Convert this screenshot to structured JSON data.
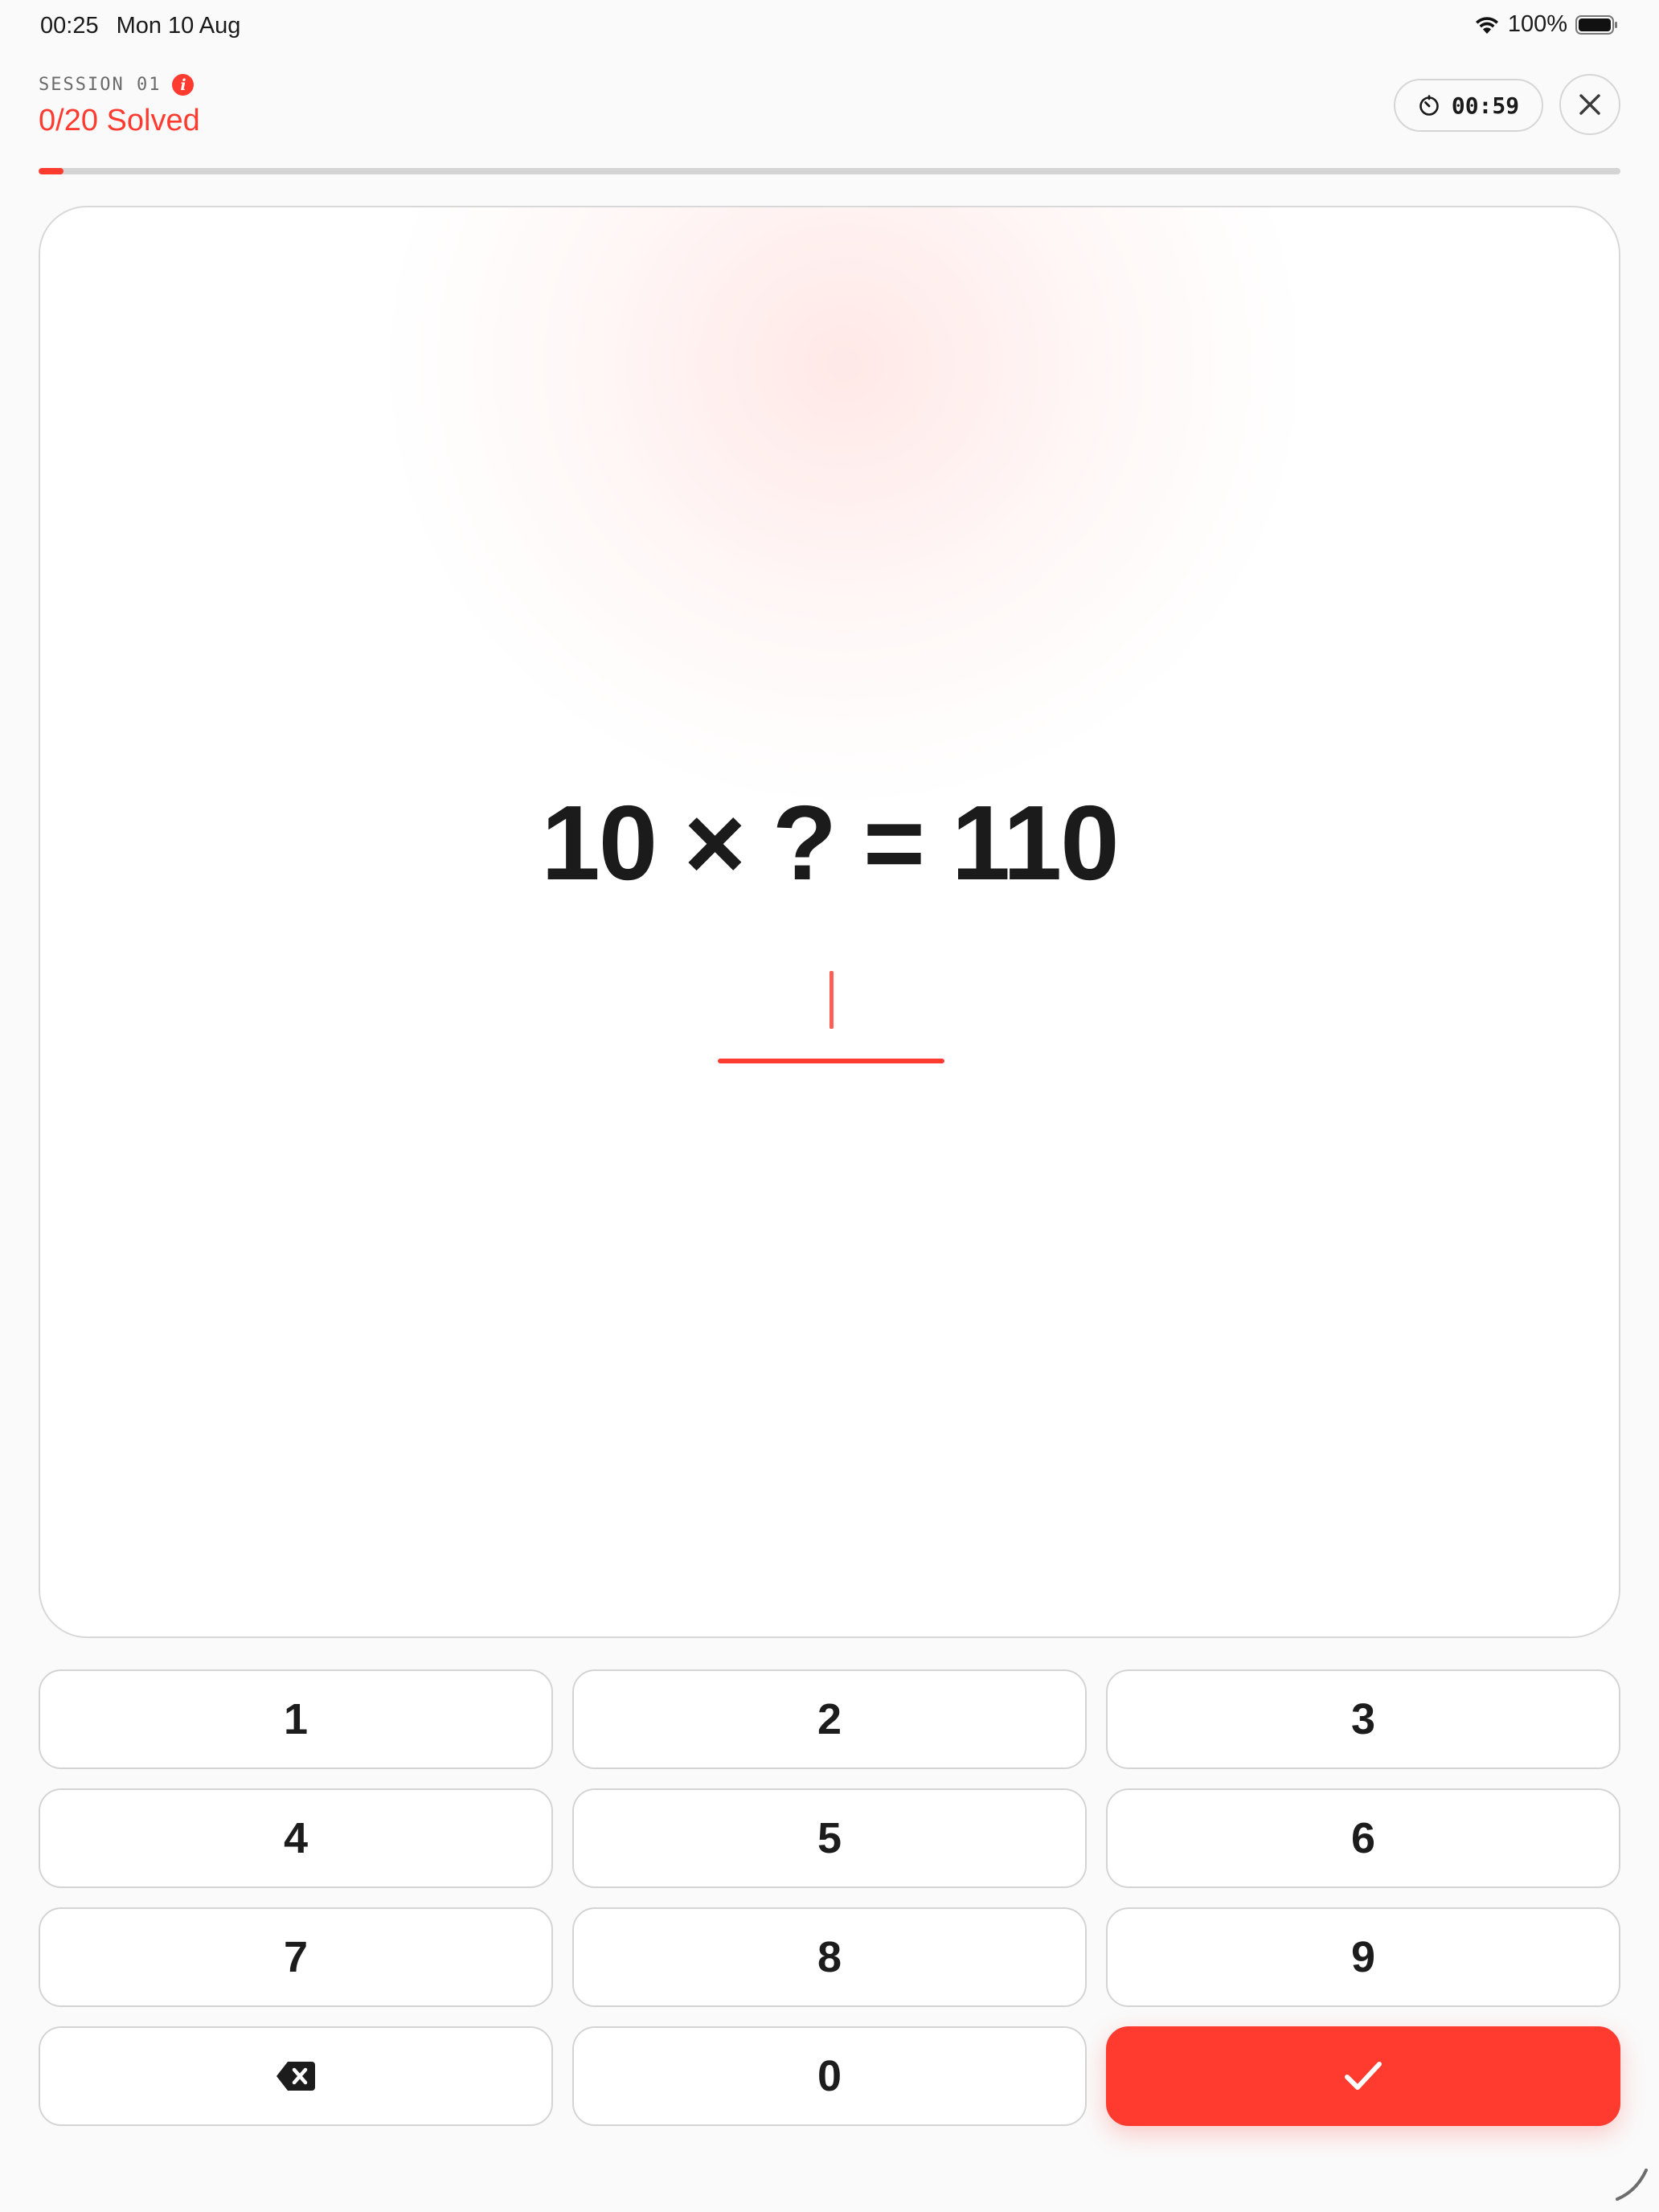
{
  "status_bar": {
    "time": "00:25",
    "date": "Mon 10 Aug",
    "battery_percent": "100%"
  },
  "header": {
    "session_label": "SESSION 01",
    "solved_text": "0/20 Solved",
    "timer": "00:59"
  },
  "progress": {
    "solved": 0,
    "total": 20,
    "fraction": 0.016
  },
  "question": {
    "equation": "10 × ? = 110",
    "answer_value": ""
  },
  "keypad": {
    "keys": [
      "1",
      "2",
      "3",
      "4",
      "5",
      "6",
      "7",
      "8",
      "9",
      "0"
    ]
  },
  "colors": {
    "accent": "#ff3b30",
    "background": "#fafafa",
    "card": "#ffffff",
    "border": "#d4d4d4"
  },
  "icons": {
    "info": "info-icon",
    "timer": "stopwatch-icon",
    "close": "close-icon",
    "backspace": "backspace-icon",
    "submit": "checkmark-icon"
  }
}
